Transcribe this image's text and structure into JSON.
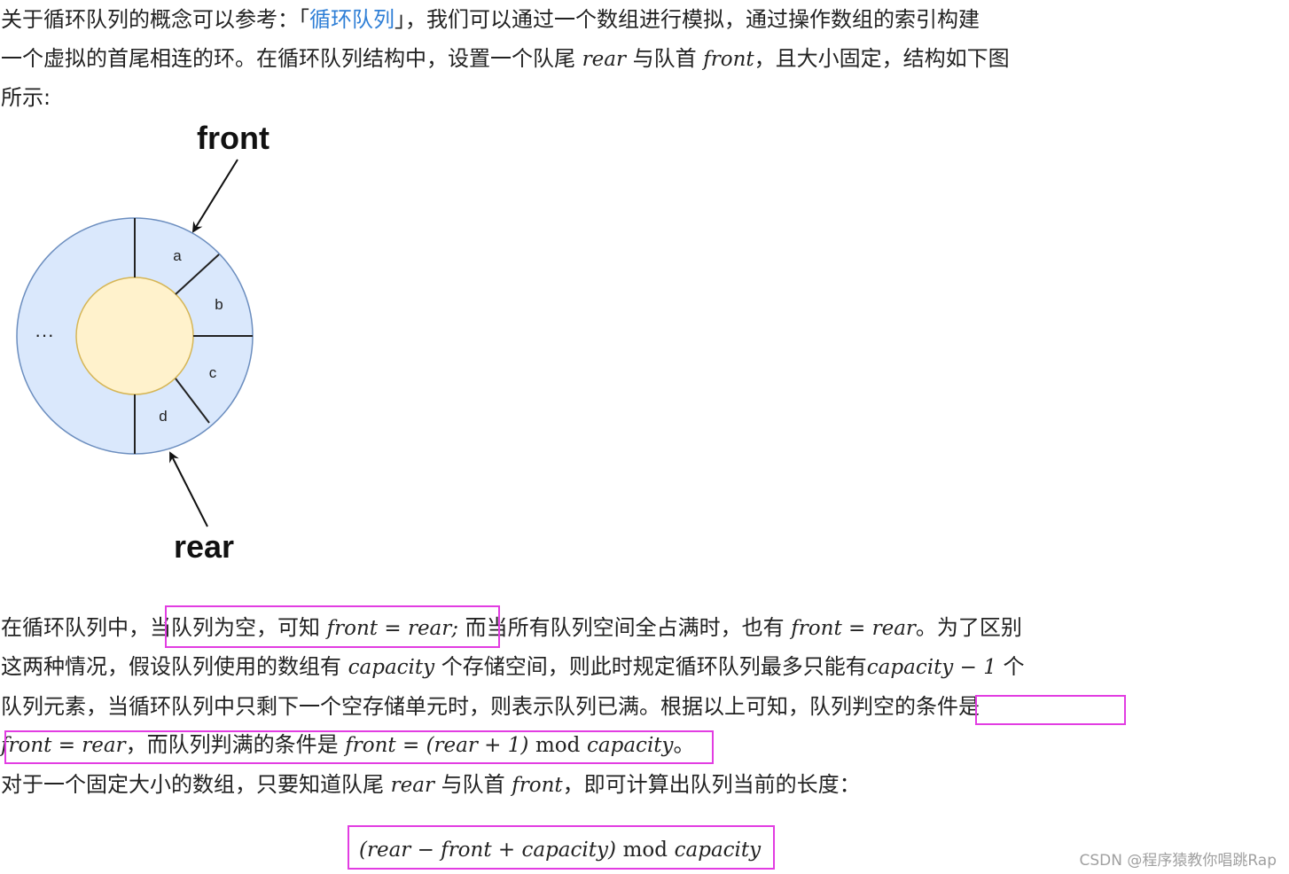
{
  "intro": {
    "l1_a": "关于循环队列的概念可以参考：「",
    "l1_link": "循环队列",
    "l1_b": "」，我们可以通过一个数组进行模拟，通过操作数组的索引构建",
    "l2_a": "一个虚拟的首尾相连的环。在循环队列结构中，设置一个队尾",
    "rear": "rear",
    "l2_b": "与队首",
    "front": "front",
    "l2_c": "，且大小固定，结构如下图",
    "l3": "所示:"
  },
  "diagram": {
    "front_label": "front",
    "rear_label": "rear",
    "segments": [
      "a",
      "b",
      "c",
      "d"
    ],
    "ellipsis": "···",
    "ring_color": "#dae8fc",
    "ring_stroke": "#6c8ebf",
    "core_color": "#fff2cc",
    "core_stroke": "#d6b656"
  },
  "body": {
    "l4_a": "在循环队列中，",
    "l4_box": "当队列为空，可知",
    "eq_empty": "front = rear;",
    "l4_b": "而当所有队列空间全占满时，也有",
    "eq_full": "front = rear",
    "l4_c": "。为了区别",
    "l5_a": "这两种情况，假设队列使用的数组有",
    "capacity": "capacity",
    "l5_b": "个存储空间，则此时规定循环队列最多只能有",
    "cap_minus": "capacity − 1",
    "l5_c": "个",
    "l6": "队列元素，当循环队列中只剩下一个空存储单元时，则表示队列已满。根据以上可知，队列判空的条件是",
    "l7_eq1": "front = rear",
    "l7_a": "，而队列判满的条件是",
    "l7_eq2_a": "front = (rear + 1)",
    "l7_mod": "mod",
    "l7_eq2_b": "capacity",
    "l7_end": "。",
    "l8_a": "对于一个固定大小的数组，只要知道队尾",
    "l8_rear": "rear",
    "l8_b": "与队首",
    "l8_front": "front",
    "l8_c": "，即可计算出队列当前的长度："
  },
  "formula": {
    "a": "(rear − front + capacity)",
    "mod": "mod",
    "b": "capacity"
  },
  "watermark": "CSDN @程序猿教你唱跳Rap",
  "colors": {
    "highlight": "#e23de2",
    "link": "#2f7fd6"
  }
}
